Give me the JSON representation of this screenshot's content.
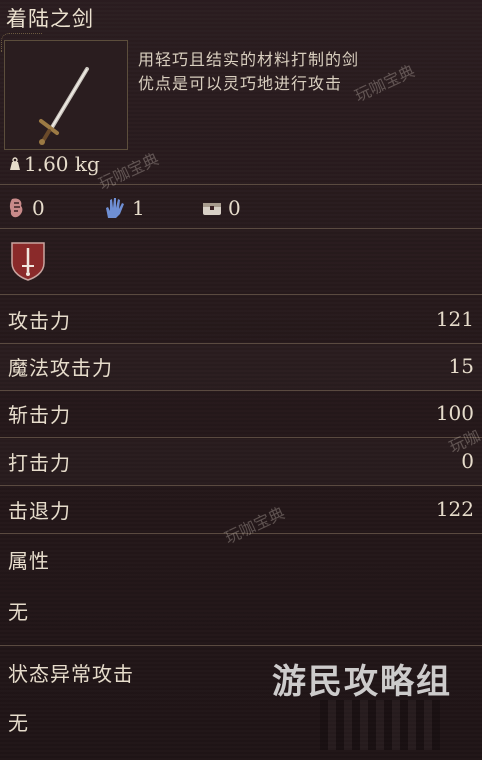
{
  "item": {
    "name": "着陆之剑",
    "description_lines": [
      "用轻巧且结实的材料打制的剑",
      "优点是可以灵巧地进行攻击"
    ],
    "weight": "1.60 kg"
  },
  "requirements": [
    {
      "icon": "strength-icon",
      "value": "0"
    },
    {
      "icon": "hand-icon",
      "value": "1"
    },
    {
      "icon": "chest-icon",
      "value": "0"
    }
  ],
  "stats": [
    {
      "label": "攻击力",
      "value": "121"
    },
    {
      "label": "魔法攻击力",
      "value": "15"
    },
    {
      "label": "斩击力",
      "value": "100"
    },
    {
      "label": "打击力",
      "value": "0"
    },
    {
      "label": "击退力",
      "value": "122"
    }
  ],
  "attribute": {
    "label": "属性",
    "value": "无"
  },
  "status_attack": {
    "label": "状态异常攻击",
    "value": "无"
  },
  "watermarks": [
    "玩咖宝典",
    "玩咖宝典",
    "玩咖宝典",
    "玩咖"
  ],
  "logo_text": "游民攻略组",
  "colors": {
    "background": "#261a1c",
    "text": "#e6dccb",
    "separator": "#5a4a40",
    "crest": "#8a2a2a"
  }
}
